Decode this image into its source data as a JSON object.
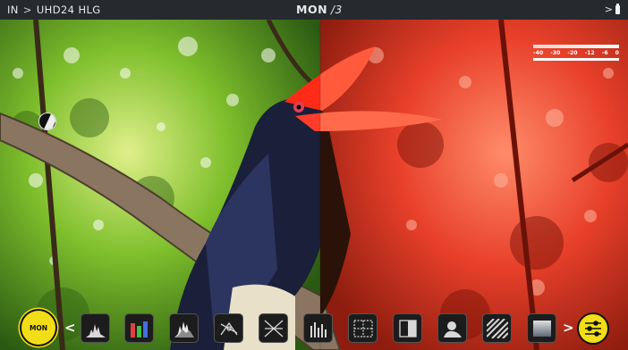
{
  "topbar": {
    "input_label": "IN",
    "separator": ">",
    "format": "UHD24 HLG",
    "mode": "MON",
    "mode_suffix": "/3",
    "right_indicator": ">"
  },
  "false_color_scale": [
    "-40",
    "-30",
    "-20",
    "-12",
    "-6",
    "0"
  ],
  "toolbar": {
    "mon_label": "MON",
    "prev": "<",
    "next": ">",
    "tools": [
      {
        "name": "luma-parade-tool",
        "icon": "luma-histogram-icon"
      },
      {
        "name": "rgb-parade-tool",
        "icon": "rgb-parade-icon"
      },
      {
        "name": "waveform-tool",
        "icon": "waveform-icon"
      },
      {
        "name": "vectorscope-tool",
        "icon": "vectorscope-icon"
      },
      {
        "name": "cross-vector-tool",
        "icon": "cross-vector-icon"
      },
      {
        "name": "audio-meters-tool",
        "icon": "audio-meters-icon"
      },
      {
        "name": "frame-guides-tool",
        "icon": "frame-guides-icon"
      },
      {
        "name": "split-screen-tool",
        "icon": "split-screen-icon"
      },
      {
        "name": "focus-peaking-tool",
        "icon": "focus-peaking-icon"
      },
      {
        "name": "zebra-tool",
        "icon": "zebra-icon"
      },
      {
        "name": "false-color-tool",
        "icon": "false-color-icon"
      }
    ]
  },
  "colors": {
    "accent": "#f2de16",
    "topbar": "#262a2e",
    "false_color": "#e8402a"
  }
}
